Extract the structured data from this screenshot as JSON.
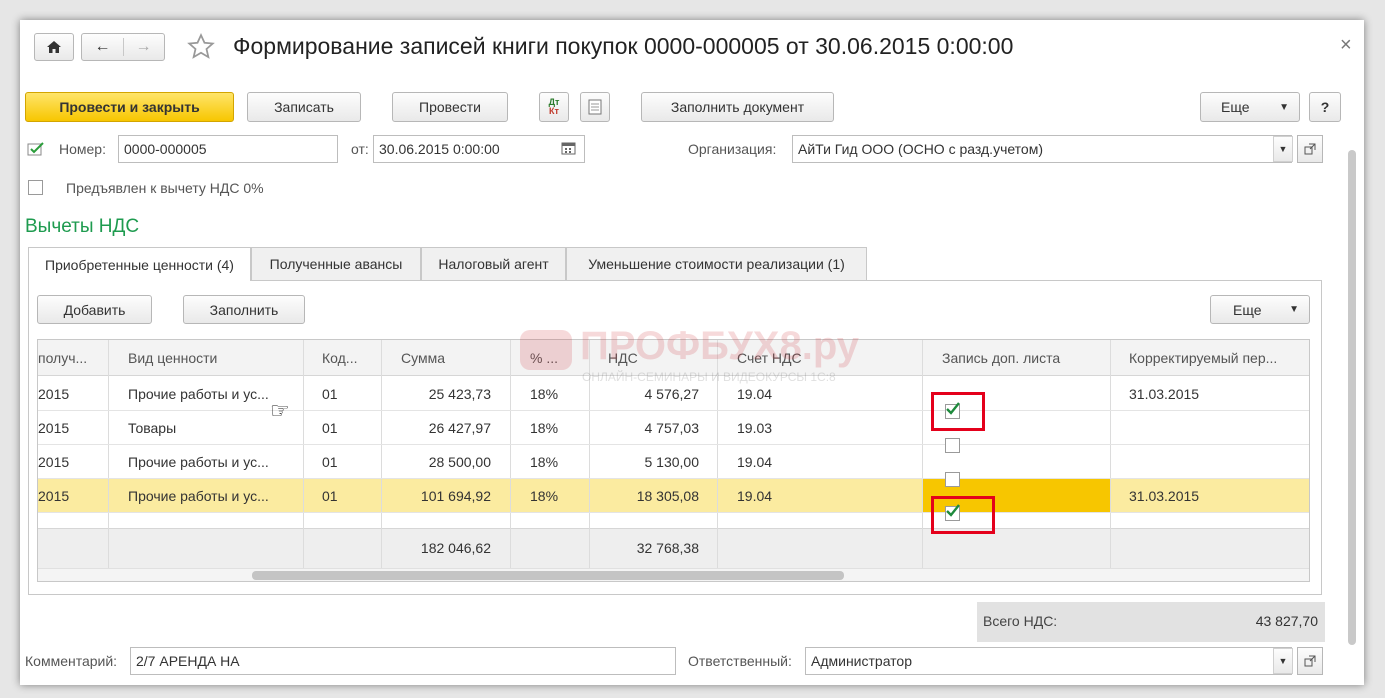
{
  "window": {
    "title": "Формирование записей книги покупок 0000-000005 от 30.06.2015 0:00:00",
    "close_glyph": "×"
  },
  "toolbar": {
    "post_close": "Провести и закрыть",
    "save": "Записать",
    "post": "Провести",
    "fill_doc": "Заполнить документ",
    "more": "Еще",
    "help": "?",
    "dt": "Дт",
    "kt": "Кт"
  },
  "header": {
    "number_label": "Номер:",
    "number": "0000-000005",
    "date_label": "от:",
    "date": "30.06.2015  0:00:00",
    "org_label": "Организация:",
    "org": "АйТи Гид ООО (ОСНО с разд.учетом)",
    "vat0_label": "Предъявлен к вычету НДС 0%"
  },
  "section_title": "Вычеты НДС",
  "tabs": [
    {
      "label": "Приобретенные ценности (4)",
      "active": true
    },
    {
      "label": "Полученные авансы",
      "active": false
    },
    {
      "label": "Налоговый агент",
      "active": false
    },
    {
      "label": "Уменьшение стоимости реализации (1)",
      "active": false
    }
  ],
  "table_toolbar": {
    "add": "Добавить",
    "fill": "Заполнить",
    "more": "Еще"
  },
  "table": {
    "columns": [
      "получ...",
      "Вид ценности",
      "Код...",
      "Сумма",
      "% ...",
      "НДС",
      "Счет НДС",
      "Запись доп. листа",
      "Корректируемый пер..."
    ],
    "rows": [
      {
        "date": "2015",
        "type": "Прочие работы и ус...",
        "code": "01",
        "sum": "25 423,73",
        "rate": "18%",
        "vat": "4 576,27",
        "account": "19.04",
        "extra": true,
        "period": "31.03.2015",
        "selected": false
      },
      {
        "date": "2015",
        "type": "Товары",
        "code": "01",
        "sum": "26 427,97",
        "rate": "18%",
        "vat": "4 757,03",
        "account": "19.03",
        "extra": false,
        "period": "",
        "selected": false
      },
      {
        "date": "2015",
        "type": "Прочие работы и ус...",
        "code": "01",
        "sum": "28 500,00",
        "rate": "18%",
        "vat": "5 130,00",
        "account": "19.04",
        "extra": false,
        "period": "",
        "selected": false
      },
      {
        "date": "2015",
        "type": "Прочие работы и ус...",
        "code": "01",
        "sum": "101 694,92",
        "rate": "18%",
        "vat": "18 305,08",
        "account": "19.04",
        "extra": true,
        "period": "31.03.2015",
        "selected": true
      }
    ],
    "totals": {
      "sum": "182 046,62",
      "vat": "32 768,38"
    }
  },
  "watermark": {
    "brand": "ПРОФБУХ8.ру",
    "tagline": "ОНЛАЙН-СЕМИНАРЫ И ВИДЕОКУРСЫ 1С:8"
  },
  "total_vat": {
    "label": "Всего НДС:",
    "value": "43 827,70"
  },
  "footer": {
    "comment_label": "Комментарий:",
    "comment": "2/7 АРЕНДА НА",
    "responsible_label": "Ответственный:",
    "responsible": "Администратор"
  },
  "colors": {
    "accent_green": "#1e9b4f",
    "primary_button": "#f7c600",
    "selected_row": "#fbeba0",
    "highlight": "#e4001b"
  }
}
